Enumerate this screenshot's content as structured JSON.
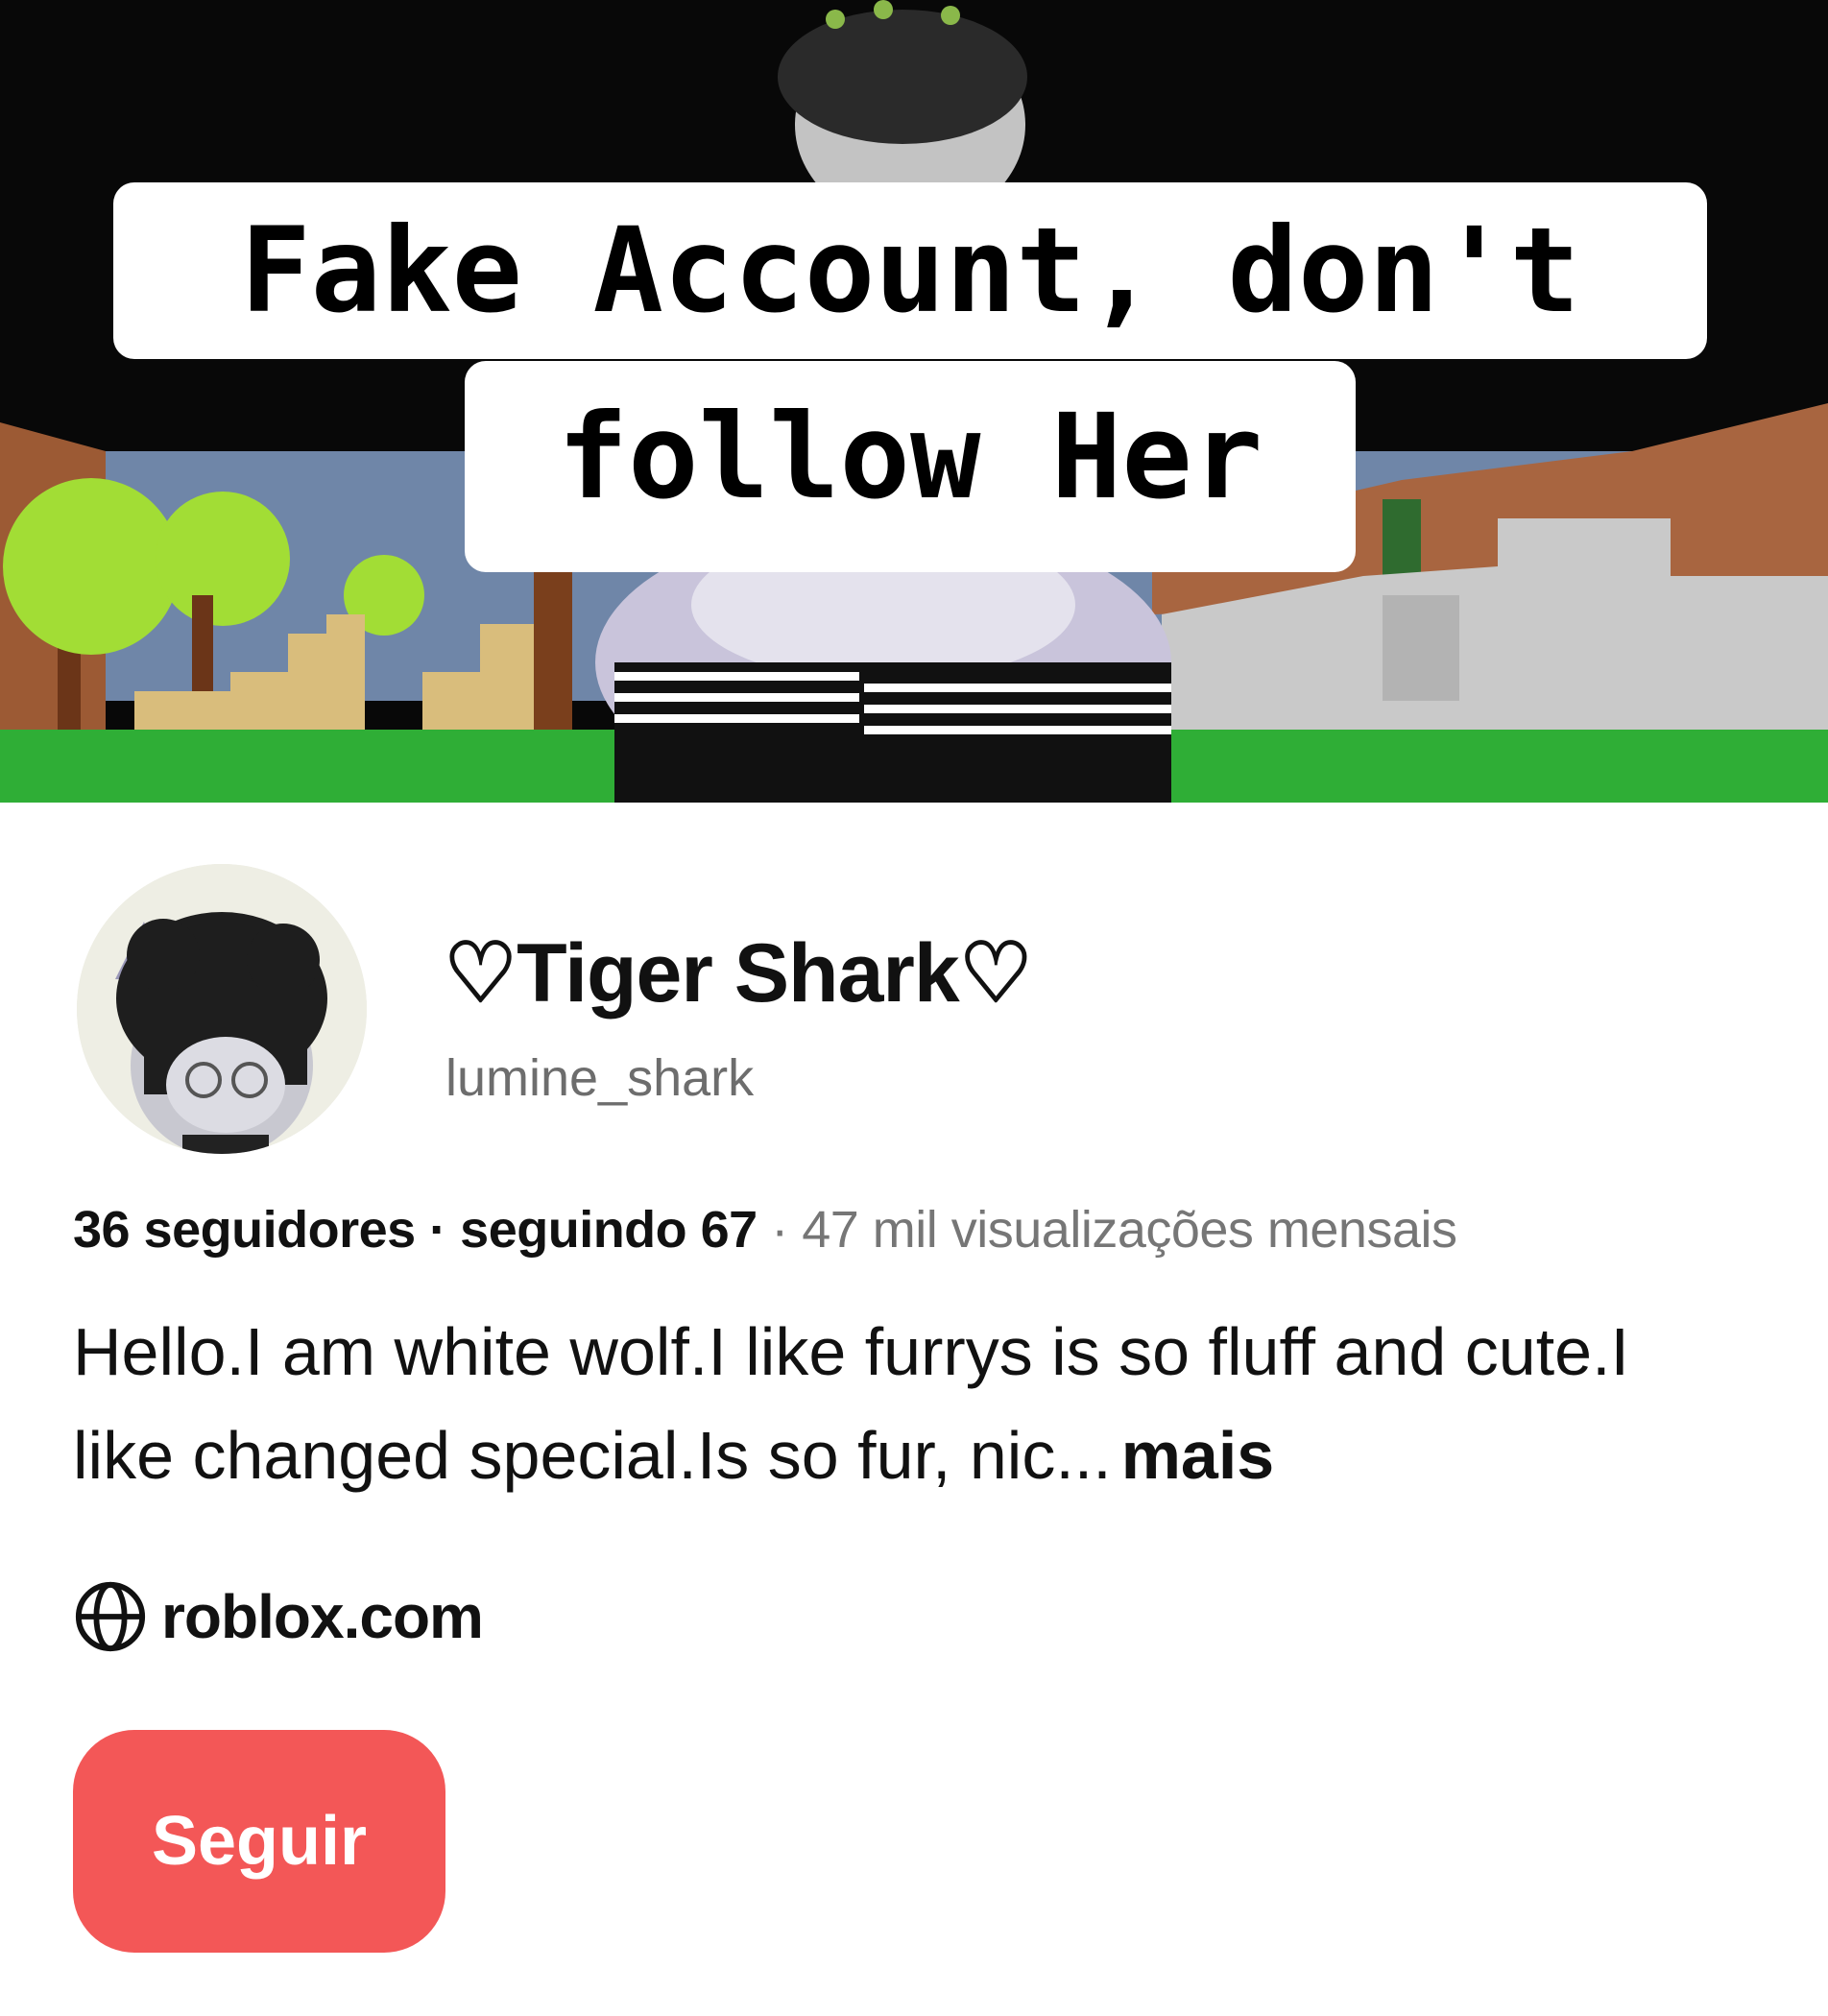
{
  "banner": {
    "overlay_line1": "Fake Account, don't",
    "overlay_line2": "follow Her"
  },
  "profile": {
    "display_name": "♡Tiger Shark♡",
    "username": "lumine_shark",
    "stats": {
      "followers": "36 seguidores",
      "sep1": " · ",
      "following": "seguindo 67",
      "sep2": " · ",
      "monthly_views": "47 mil visualizações mensais"
    },
    "bio": "Hello.I am white wolf.I like furrys is so fluff and cute.I like changed special.Is so fur, nic...",
    "bio_more": "mais",
    "website_icon": "globe-icon",
    "website": "roblox.com",
    "follow_button": "Seguir"
  },
  "colors": {
    "follow_button": "#f35757",
    "sky": "#080808",
    "grass": "#2fae36",
    "muted_text": "#767676"
  }
}
